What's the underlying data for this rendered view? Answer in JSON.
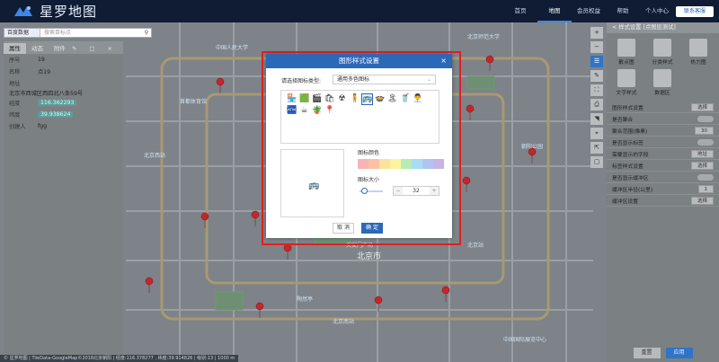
{
  "header": {
    "logo_text": "星罗地图",
    "nav": [
      "首页",
      "地图",
      "会员权益",
      "帮助",
      "个人中心",
      "退出"
    ],
    "active_nav": "地图",
    "contact_label": "联系客服"
  },
  "search": {
    "category": "百度数据",
    "placeholder": "搜索目标点"
  },
  "left_panel": {
    "tabs": [
      "属性",
      "动态",
      "附件"
    ],
    "rows": [
      {
        "key": "序号",
        "value": "19"
      },
      {
        "key": "名称",
        "value": "点19"
      },
      {
        "key": "地址",
        "value": ""
      },
      {
        "key": "经度",
        "value": "116.362293"
      },
      {
        "key": "纬度",
        "value": "39.938624"
      },
      {
        "key": "创建人",
        "value": "fgg"
      }
    ],
    "address_value": "北京市西城区西四北八条59号"
  },
  "map": {
    "city_label": "北京市",
    "labels": [
      "北京西站",
      "首都体育馆",
      "中国人民大学",
      "北京师范大学",
      "天安门广场",
      "北京站",
      "北京南站",
      "陶然亭",
      "朝阳公园",
      "中国国际展览中心"
    ],
    "status_text": "© 星罗地图 | TileData-GoogleMap©2018北京朝阳 | 经度:116.378277 , 纬度:39.914826 | 级别:13 | 1000 m"
  },
  "right_panel": {
    "title": "< 样式设置 [点图层测试]",
    "styles": [
      {
        "label": "散点图"
      },
      {
        "label": "分类样式"
      },
      {
        "label": "热力图"
      },
      {
        "label": "文字样式"
      },
      {
        "label": "数据区"
      }
    ],
    "rows": [
      {
        "label": "图形样式设置",
        "control": "选择"
      },
      {
        "label": "是否聚合",
        "control": "toggle"
      },
      {
        "label": "聚合范围(像素)",
        "control": "30"
      },
      {
        "label": "是否显示标签",
        "control": "toggle"
      },
      {
        "label": "需要显示的字段",
        "control": "地址"
      },
      {
        "label": "标签样式设置",
        "control": "选择"
      },
      {
        "label": "是否显示缓冲区",
        "control": "toggle"
      },
      {
        "label": "缓冲区半径(公里)",
        "control": "1"
      },
      {
        "label": "缓冲区设置",
        "control": "选择"
      }
    ],
    "reset_label": "重置",
    "apply_label": "应用"
  },
  "modal": {
    "title": "图形样式设置",
    "type_label": "请选择图标类型:",
    "type_value": "通用多色图标",
    "icons": [
      "🏪",
      "🟩",
      "🎬",
      "🛍",
      "☢",
      "🧍",
      "🚌",
      "🍲",
      "🏝",
      "🥤",
      "👨‍💼",
      "🏧",
      "☕",
      "🪴",
      "📍"
    ],
    "color_label": "图标颜色",
    "colors": [
      "#f8b4b4",
      "#fcc0a4",
      "#fde29c",
      "#fef3a0",
      "#b8ecb0",
      "#a9dcf2",
      "#b0c4f0",
      "#c8b4e4"
    ],
    "size_label": "图标大小",
    "size_value": "32",
    "size_fraction": 0.18,
    "cancel_label": "取 消",
    "ok_label": "确 定"
  }
}
